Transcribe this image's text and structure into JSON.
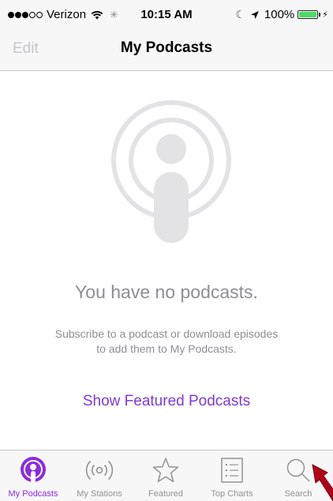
{
  "status_bar": {
    "carrier": "Verizon",
    "time": "10:15 AM",
    "battery_percent": "100%",
    "signal_bars_full": 3,
    "signal_bars_total": 5,
    "battery_level": 1.0,
    "icons": [
      "signal-dots-icon",
      "wifi-icon",
      "activity-spinner-icon",
      "moon-icon",
      "location-arrow-icon",
      "battery-icon",
      "charging-bolt-icon"
    ]
  },
  "nav_bar": {
    "edit_label": "Edit",
    "title": "My Podcasts"
  },
  "empty_state": {
    "icon": "podcast-icon",
    "title": "You have no podcasts.",
    "description_line1": "Subscribe to a podcast or download episodes",
    "description_line2": "to add them to My Podcasts.",
    "link_label": "Show Featured Podcasts"
  },
  "tab_bar": {
    "tabs": [
      {
        "label": "My Podcasts",
        "icon": "podcast-icon",
        "active": true
      },
      {
        "label": "My Stations",
        "icon": "radio-waves-icon",
        "active": false
      },
      {
        "label": "Featured",
        "icon": "star-icon",
        "active": false
      },
      {
        "label": "Top Charts",
        "icon": "list-icon",
        "active": false
      },
      {
        "label": "Search",
        "icon": "search-icon",
        "active": false
      }
    ]
  },
  "colors": {
    "accent": "#8a2be2",
    "link": "#7e3ad6",
    "muted_text": "#8e8e93",
    "disabled_text": "#c7c7cc",
    "bar_background": "#f7f7f8",
    "separator": "#c8c7cc",
    "empty_icon": "#e3e3e6",
    "battery_fill": "#4cd964",
    "annotation_arrow": "#b3001b"
  },
  "annotation": {
    "icon": "red-arrow-icon"
  }
}
